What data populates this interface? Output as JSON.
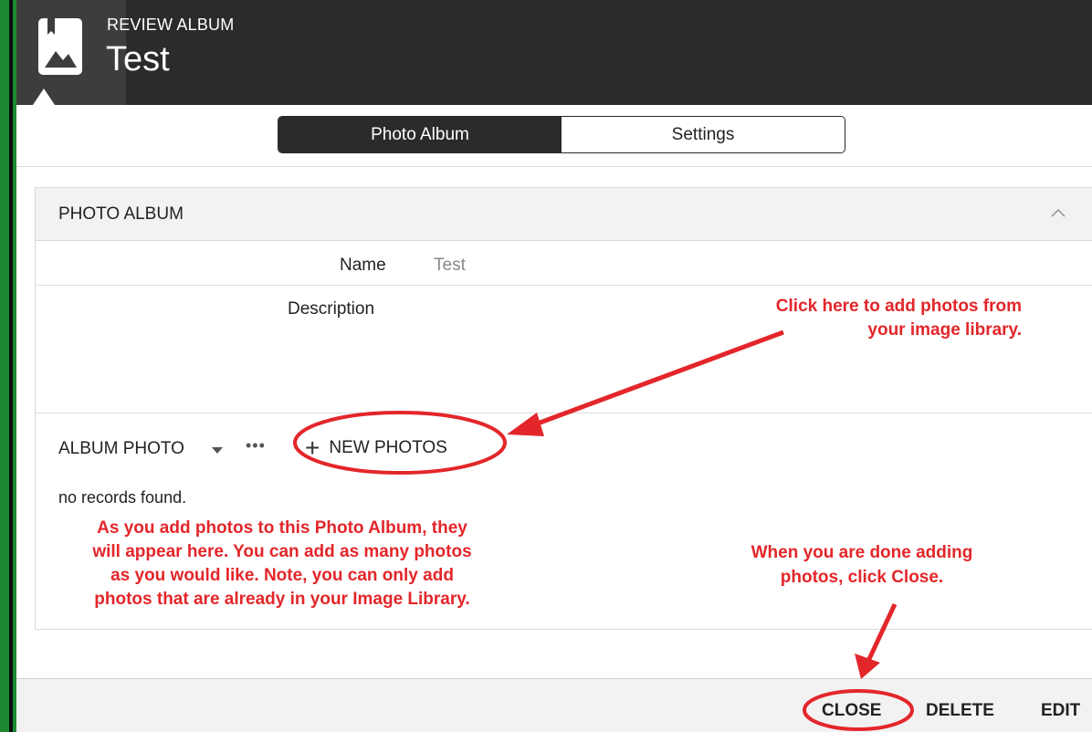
{
  "header": {
    "subtitle": "REVIEW ALBUM",
    "title": "Test",
    "icon": "photo-album-icon"
  },
  "tabs": [
    {
      "label": "Photo Album",
      "active": true
    },
    {
      "label": "Settings",
      "active": false
    }
  ],
  "section": {
    "title": "PHOTO ALBUM",
    "collapse_icon": "chevron-up-icon",
    "fields": {
      "name_label": "Name",
      "name_value": "Test",
      "description_label": "Description",
      "description_value": ""
    }
  },
  "album_photo": {
    "label": "ALBUM PHOTO",
    "more": "•••",
    "new_photos_label": "NEW PHOTOS",
    "empty_text": "no records found."
  },
  "annotations": {
    "new_photos_note": "Click here to add photos from your image library.",
    "new_photos_note_line1": "Click here to add photos from",
    "new_photos_note_line2": "your image library.",
    "album_note_line1": "As you add photos to this Photo Album, they",
    "album_note_line2": "will appear here. You can add as many photos",
    "album_note_line3": "as you would like. Note, you can only add",
    "album_note_line4": "photos that are already in your Image Library.",
    "close_note_line1": "When you are done adding",
    "close_note_line2": "photos, click Close.",
    "color": "#e3262a"
  },
  "footer": {
    "close_label": "CLOSE",
    "delete_label": "DELETE",
    "edit_label": "EDIT"
  },
  "colors": {
    "header_bg": "#2b2b2b",
    "frame_green": "#1d8a33",
    "annotation_red": "#e3262a"
  }
}
